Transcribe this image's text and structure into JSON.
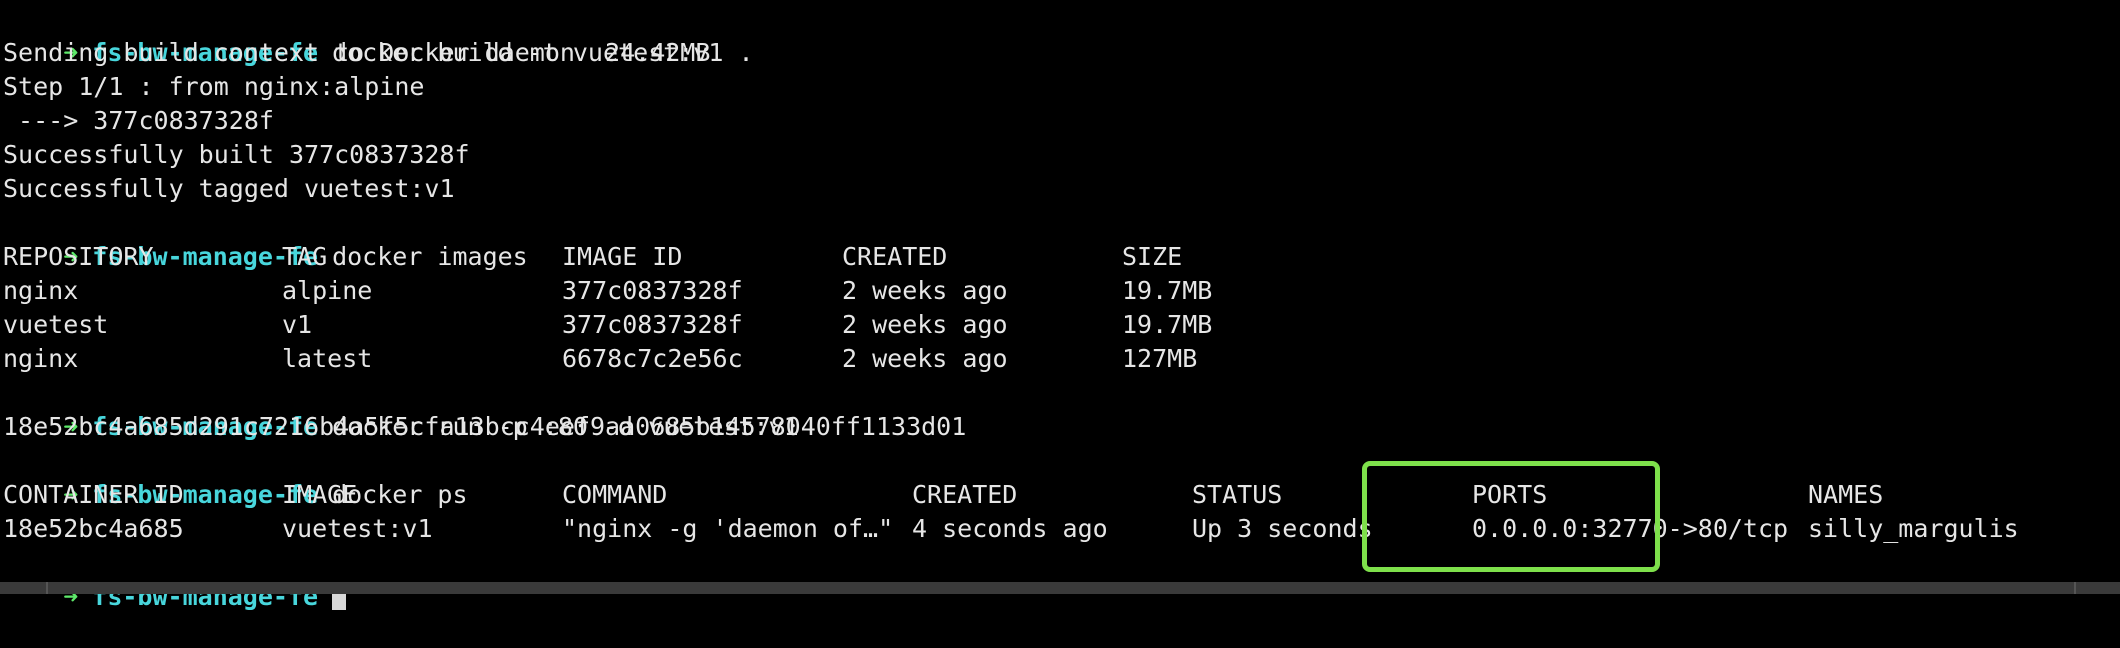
{
  "prompt": {
    "arrow": "➜",
    "dir": "fs-bw-manage-fe"
  },
  "build": {
    "command": "docker build -t vuetest:v1 .",
    "output": [
      "Sending build context to Docker daemon  24.42MB",
      "Step 1/1 : from nginx:alpine",
      " ---> 377c0837328f",
      "Successfully built 377c0837328f",
      "Successfully tagged vuetest:v1"
    ]
  },
  "images": {
    "command": "docker images",
    "headers": [
      "REPOSITORY",
      "TAG",
      "IMAGE ID",
      "CREATED",
      "SIZE"
    ],
    "rows": [
      [
        "nginx",
        "alpine",
        "377c0837328f",
        "2 weeks ago",
        "19.7MB"
      ],
      [
        "vuetest",
        "v1",
        "377c0837328f",
        "2 weeks ago",
        "19.7MB"
      ],
      [
        "nginx",
        "latest",
        "6678c7c2e56c",
        "2 weeks ago",
        "127MB"
      ]
    ]
  },
  "run": {
    "command": "docker run -p :80 -d vuetest:v1",
    "output": "18e52bc4a685d291c7216b4a5f5cfa13bcc4eef9aa0685b14578040ff1133d01"
  },
  "ps": {
    "command": "docker ps",
    "headers": [
      "CONTAINER ID",
      "IMAGE",
      "COMMAND",
      "CREATED",
      "STATUS",
      "PORTS",
      "NAMES"
    ],
    "rows": [
      [
        "18e52bc4a685",
        "vuetest:v1",
        "\"nginx -g 'daemon of…\"",
        "4 seconds ago",
        "Up 3 seconds",
        "0.0.0.0:32770->80/tcp",
        "silly_margulis"
      ]
    ]
  },
  "colors": {
    "background": "#000000",
    "text": "#e6e6e6",
    "prompt_arrow": "#5ee86a",
    "prompt_dir": "#48d6dc",
    "highlight_box": "#7ee04b"
  }
}
